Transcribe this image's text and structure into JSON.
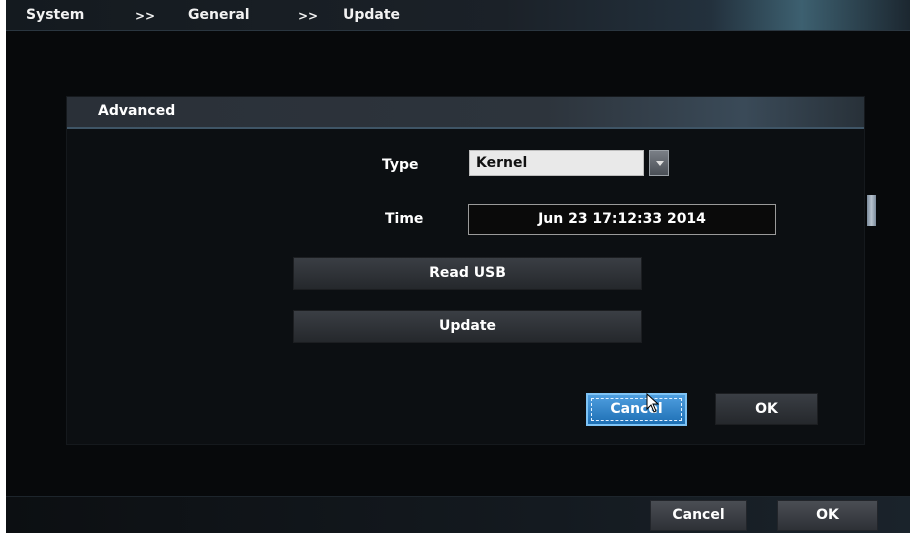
{
  "breadcrumb": {
    "items": [
      "System",
      "General",
      "Update"
    ],
    "separator": ">>"
  },
  "panel": {
    "title": "Advanced",
    "type_label": "Type",
    "type_value": "Kernel",
    "time_label": "Time",
    "time_value": "Jun 23 17:12:33 2014",
    "read_usb_label": "Read USB",
    "update_label": "Update",
    "cancel_label": "Cancel",
    "ok_label": "OK"
  },
  "footer": {
    "cancel_label": "Cancel",
    "ok_label": "OK"
  },
  "colors": {
    "background": "#000000",
    "focus_button": "#2f86cf",
    "panel_header": "#2d343c"
  },
  "icons": [
    "dropdown-arrow-icon",
    "mouse-pointer-icon"
  ]
}
